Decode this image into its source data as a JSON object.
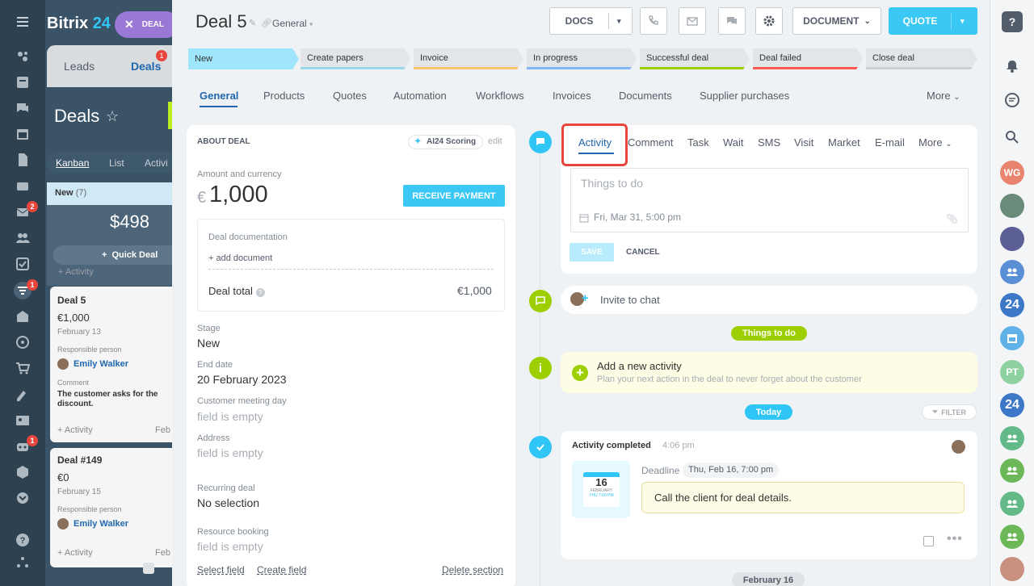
{
  "app": {
    "logo": "Bitrix",
    "logo_num": "24",
    "deal_chip": "DEAL"
  },
  "left_nav": {
    "badges": [
      "2",
      "1",
      "1"
    ]
  },
  "crm": {
    "tab_leads": "Leads",
    "tab_deals": "Deals",
    "deals_badge": "1",
    "title": "Deals",
    "views": [
      "Kanban",
      "List",
      "Activi"
    ],
    "column": {
      "name": "New",
      "count": "(7)",
      "sum": "$498",
      "quick": "Quick Deal",
      "cut": "+ Activity"
    },
    "cards": [
      {
        "title": "Deal 5",
        "amount": "€1,000",
        "date": "February 13",
        "resp_label": "Responsible person",
        "person": "Emily Walker",
        "comment_label": "Comment",
        "comment": "The customer asks for the",
        "comment2": "discount.",
        "activity": "+ Activity",
        "feb": "Feb"
      },
      {
        "title": "Deal #149",
        "amount": "€0",
        "date": "February 15",
        "resp_label": "Responsible person",
        "person": "Emily Walker",
        "activity": "+ Activity",
        "feb": "Feb"
      }
    ]
  },
  "deal": {
    "title": "Deal 5",
    "pipeline": "General",
    "buttons": {
      "docs": "DOCS",
      "document": "DOCUMENT",
      "quote": "QUOTE"
    },
    "stages": [
      "New",
      "Create papers",
      "Invoice",
      "In progress",
      "Successful deal",
      "Deal failed",
      "Close deal"
    ],
    "tabs": [
      "General",
      "Products",
      "Quotes",
      "Automation",
      "Workflows",
      "Invoices",
      "Documents",
      "Supplier purchases"
    ],
    "tabs_more": "More"
  },
  "about": {
    "header": "ABOUT DEAL",
    "ai": "AI24 Scoring",
    "edit": "edit",
    "amount_label": "Amount and currency",
    "currency": "€",
    "amount": "1,000",
    "receive": "RECEIVE PAYMENT",
    "doc_label": "Deal documentation",
    "add_doc": "+ add document",
    "total_label": "Deal total",
    "total": "€1,000",
    "stage_label": "Stage",
    "stage": "New",
    "end_label": "End date",
    "end": "20 February 2023",
    "meet_label": "Customer meeting day",
    "meet": "field is empty",
    "addr_label": "Address",
    "addr": "field is empty",
    "rec_label": "Recurring deal",
    "rec": "No selection",
    "res_label": "Resource booking",
    "res": "field is empty",
    "select_field": "Select field",
    "create_field": "Create field",
    "delete_section": "Delete section"
  },
  "timeline": {
    "tabs": [
      "Activity",
      "Comment",
      "Task",
      "Wait",
      "SMS",
      "Visit",
      "Market",
      "E-mail"
    ],
    "more": "More",
    "placeholder": "Things to do",
    "date": "Fri, Mar 31, 5:00 pm",
    "save": "SAVE",
    "cancel": "CANCEL",
    "invite": "Invite to chat",
    "todo_pill": "Things to do",
    "add_title": "Add a new activity",
    "add_sub": "Plan your next action in the deal to never forget about the customer",
    "today": "Today",
    "filter": "FILTER",
    "done_title": "Activity completed",
    "done_time": "4:06 pm",
    "cal_day": "16",
    "cal_month": "FEBRUARY",
    "cal_time": "THU 7:00 PM",
    "deadline_label": "Deadline",
    "deadline": "Thu, Feb 16, 7:00 pm",
    "task": "Call the client for deal details.",
    "feb16": "February 16"
  },
  "right_bar": {
    "avatars": [
      "WG",
      "PT"
    ]
  }
}
